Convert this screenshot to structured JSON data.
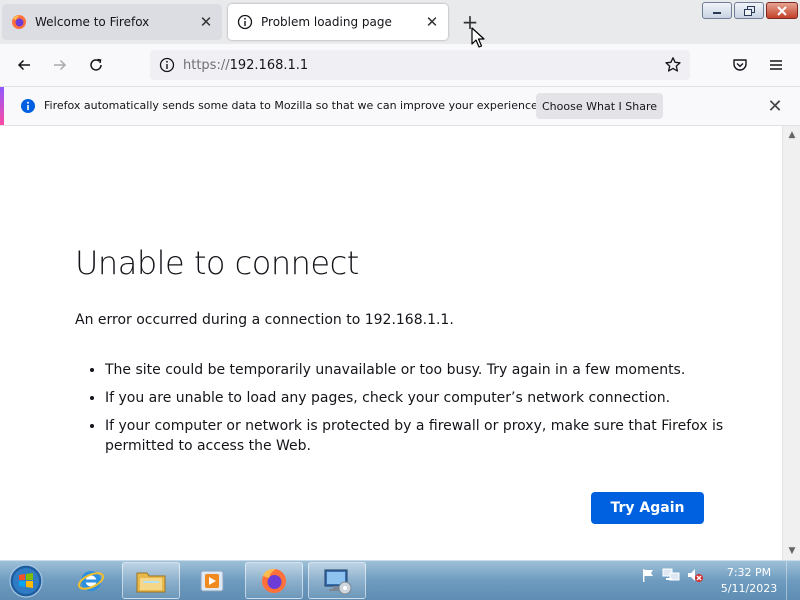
{
  "tabs": [
    {
      "label": "Welcome to Firefox",
      "icon": "firefox-logo-icon",
      "active": false
    },
    {
      "label": "Problem loading page",
      "icon": "info-icon",
      "active": true
    }
  ],
  "window_controls": {
    "minimize": "minimize-icon",
    "restore": "restore-icon",
    "close": "close-icon"
  },
  "navbar": {
    "url_protocol": "https://",
    "url_host": "192.168.1.1"
  },
  "notification": {
    "text": "Firefox automatically sends some data to Mozilla so that we can improve your experience.",
    "button_label": "Choose What I Share"
  },
  "error_page": {
    "title": "Unable to connect",
    "description": "An error occurred during a connection to 192.168.1.1.",
    "bullets": [
      "The site could be temporarily unavailable or too busy. Try again in a few moments.",
      "If you are unable to load any pages, check your computer’s network connection.",
      "If your computer or network is protected by a firewall or proxy, make sure that Firefox is permitted to access the Web."
    ],
    "button_label": "Try Again"
  },
  "taskbar": {
    "items": [
      "start-orb-icon",
      "internet-explorer-icon",
      "file-explorer-icon",
      "media-player-icon",
      "firefox-icon",
      "remote-desktop-icon"
    ],
    "clock_time": "7:32 PM",
    "clock_date": "5/11/2023"
  },
  "colors": {
    "accent_blue": "#0061e0",
    "info_blue": "#0060df",
    "tabstrip_bg": "#e9eaec"
  }
}
